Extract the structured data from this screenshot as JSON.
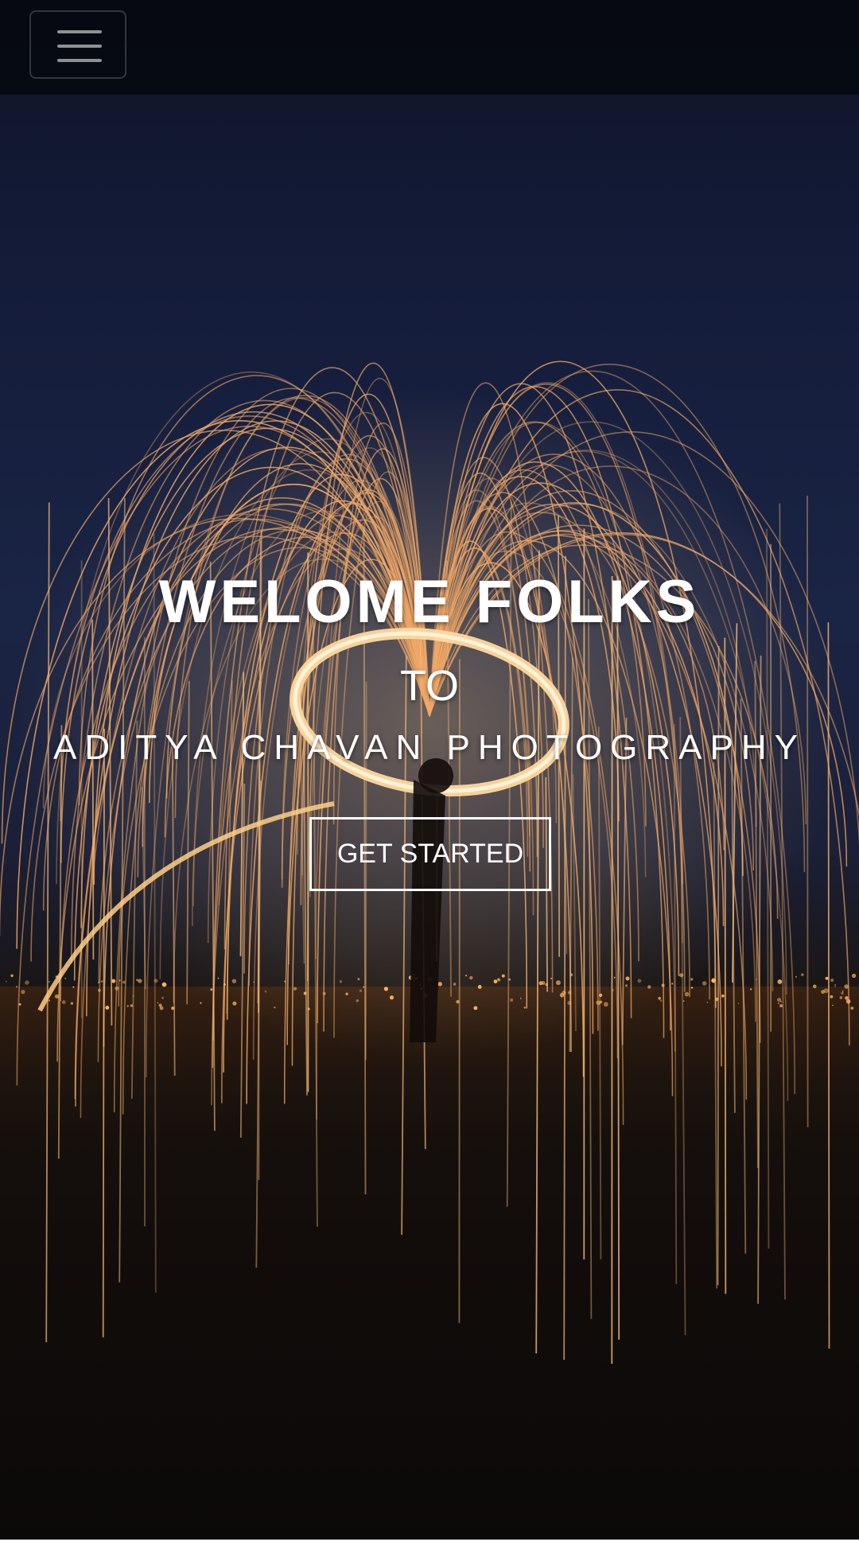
{
  "navbar": {
    "toggle_icon": "hamburger-menu-icon"
  },
  "hero": {
    "background": "steel-wool spark light-painting photo at night",
    "heading": "WELOME FOLKS",
    "subheading": "TO",
    "brand": "ADITYA CHAVAN PHOTOGRAPHY",
    "cta_label": "GET STARTED"
  },
  "colors": {
    "navbar_bg": "#05070e",
    "text": "#ffffff",
    "spark": "#f2b06a",
    "ring": "#ffd48a"
  }
}
